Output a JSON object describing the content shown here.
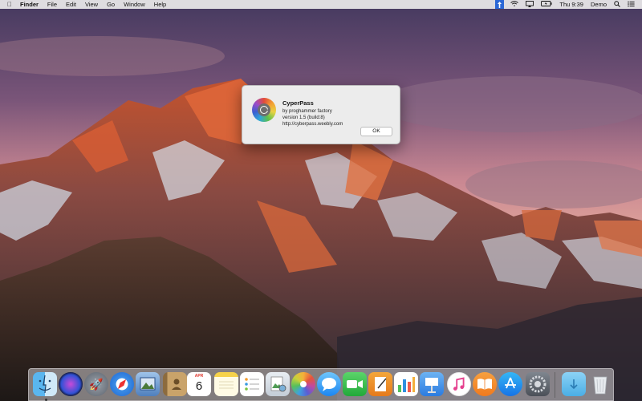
{
  "menubar": {
    "apple_icon": "apple-logo-icon",
    "app_name": "Finder",
    "menus": [
      "File",
      "Edit",
      "View",
      "Go",
      "Window",
      "Help"
    ],
    "status": {
      "clock": "Thu 9:39",
      "user": "Demo"
    }
  },
  "dialog": {
    "app_title": "CyperPass",
    "by_line": "by proghammer factory",
    "version_line": "version 1.5 (build:8)",
    "url_line": "http://cyberpass.weebly.com",
    "ok_label": "OK"
  },
  "dock": {
    "calendar_month": "APR",
    "calendar_day": "6",
    "apps": [
      "finder-icon",
      "siri-icon",
      "launchpad-icon",
      "safari-icon",
      "photo-editor-icon",
      "contacts-icon",
      "calendar-icon",
      "notes-icon",
      "reminders-icon",
      "preview-icon",
      "photos-icon",
      "messages-icon",
      "facetime-icon",
      "pages-icon",
      "numbers-icon",
      "keynote-icon",
      "itunes-icon",
      "ibooks-icon",
      "app-store-icon",
      "system-preferences-icon",
      "downloads-folder-icon",
      "trash-icon"
    ]
  },
  "colors": {
    "menubar_selected": "#2b67d6",
    "dialog_bg": "#ececec"
  }
}
